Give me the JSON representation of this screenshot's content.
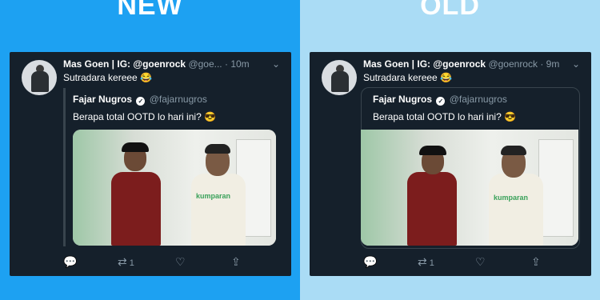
{
  "left": {
    "heading": "NEW",
    "tweet": {
      "name": "Mas Goen | IG: @goenrock",
      "handle": "@goe...",
      "time": "· 10m",
      "text": "Sutradara kereee 😂",
      "quote": {
        "name": "Fajar Nugros",
        "handle": "@fajarnugros",
        "text": "Berapa total OOTD lo hari ini? 😎"
      },
      "retweet_count": "1"
    }
  },
  "right": {
    "heading": "OLD",
    "tweet": {
      "name": "Mas Goen | IG: @goenrock",
      "handle": "@goenrock",
      "time": "· 9m",
      "text": "Sutradara kereee 😂",
      "quote": {
        "name": "Fajar Nugros",
        "handle": "@fajarnugros",
        "text": "Berapa total OOTD lo hari ini? 😎"
      },
      "retweet_count": "1"
    }
  },
  "media_logo_text": "kumparan",
  "colors": {
    "new_bg": "#1da1f2",
    "old_bg": "#aadcf5",
    "card_bg": "#15202b",
    "secondary_text": "#8899a6"
  },
  "icons": [
    "chevron-down-icon",
    "verified-badge-icon",
    "reply-icon",
    "retweet-icon",
    "like-icon",
    "share-icon"
  ]
}
